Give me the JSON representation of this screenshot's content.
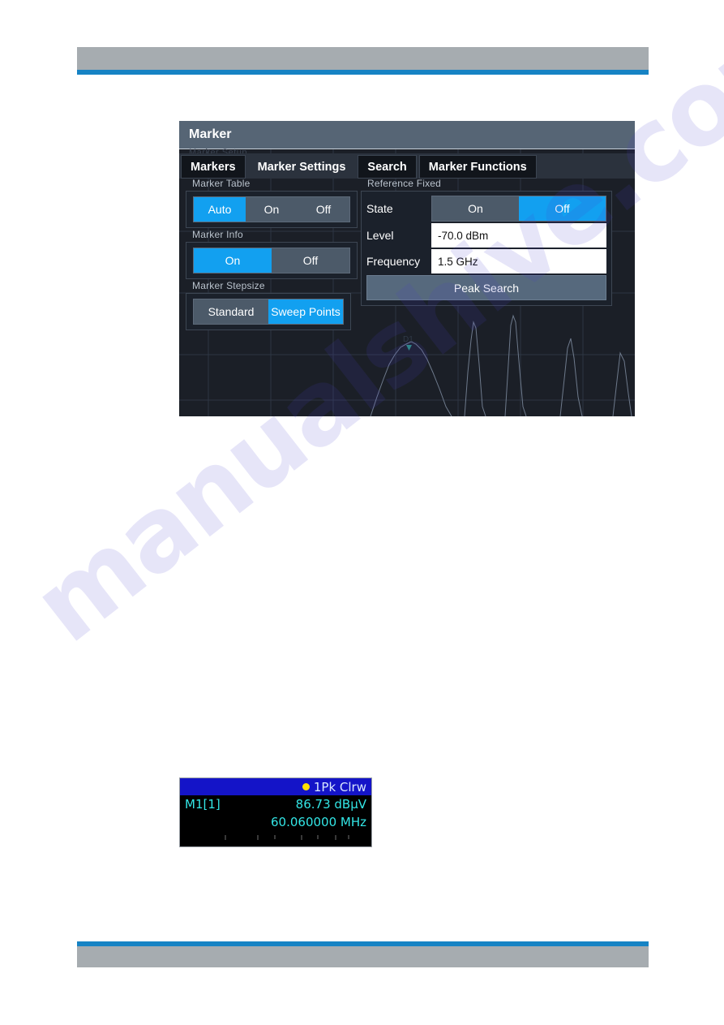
{
  "page": {
    "watermark": "manualshive.com"
  },
  "dialog": {
    "title": "Marker",
    "ghost_label": "Marker Setup",
    "tabs": [
      {
        "label": "Markers",
        "active": false
      },
      {
        "label": "Marker Settings",
        "active": true
      },
      {
        "label": "Search",
        "active": false
      },
      {
        "label": "Marker Functions",
        "active": false
      }
    ],
    "marker_table": {
      "group_label": "Marker Table",
      "options": [
        "Auto",
        "On",
        "Off"
      ],
      "selected": "Auto"
    },
    "marker_info": {
      "group_label": "Marker Info",
      "options": [
        "On",
        "Off"
      ],
      "selected": "On"
    },
    "marker_stepsize": {
      "group_label": "Marker Stepsize",
      "options": [
        "Standard",
        "Sweep Points"
      ],
      "selected": "Sweep Points"
    },
    "reference_fixed": {
      "group_label": "Reference Fixed",
      "state": {
        "label": "State",
        "options": [
          "On",
          "Off"
        ],
        "selected": "Off"
      },
      "level": {
        "label": "Level",
        "value": "-70.0 dBm"
      },
      "frequency": {
        "label": "Frequency",
        "value": "1.5 GHz"
      },
      "peak_search_label": "Peak Search"
    }
  },
  "marker_info_box": {
    "trace_label": "1Pk Clrw",
    "marker_name": "M1[1]",
    "level": "86.73 dBµV",
    "frequency": "60.060000 MHz"
  },
  "colors": {
    "accent_blue": "#12a0f0",
    "rule_blue": "#1683c4",
    "band_gray": "#a6acb0",
    "panel_dark": "#1b212b",
    "title_bar": "#566575",
    "marker_cyan": "#33e6e6",
    "marker_header_blue": "#1414c8",
    "marker_dot_yellow": "#ffe000"
  }
}
